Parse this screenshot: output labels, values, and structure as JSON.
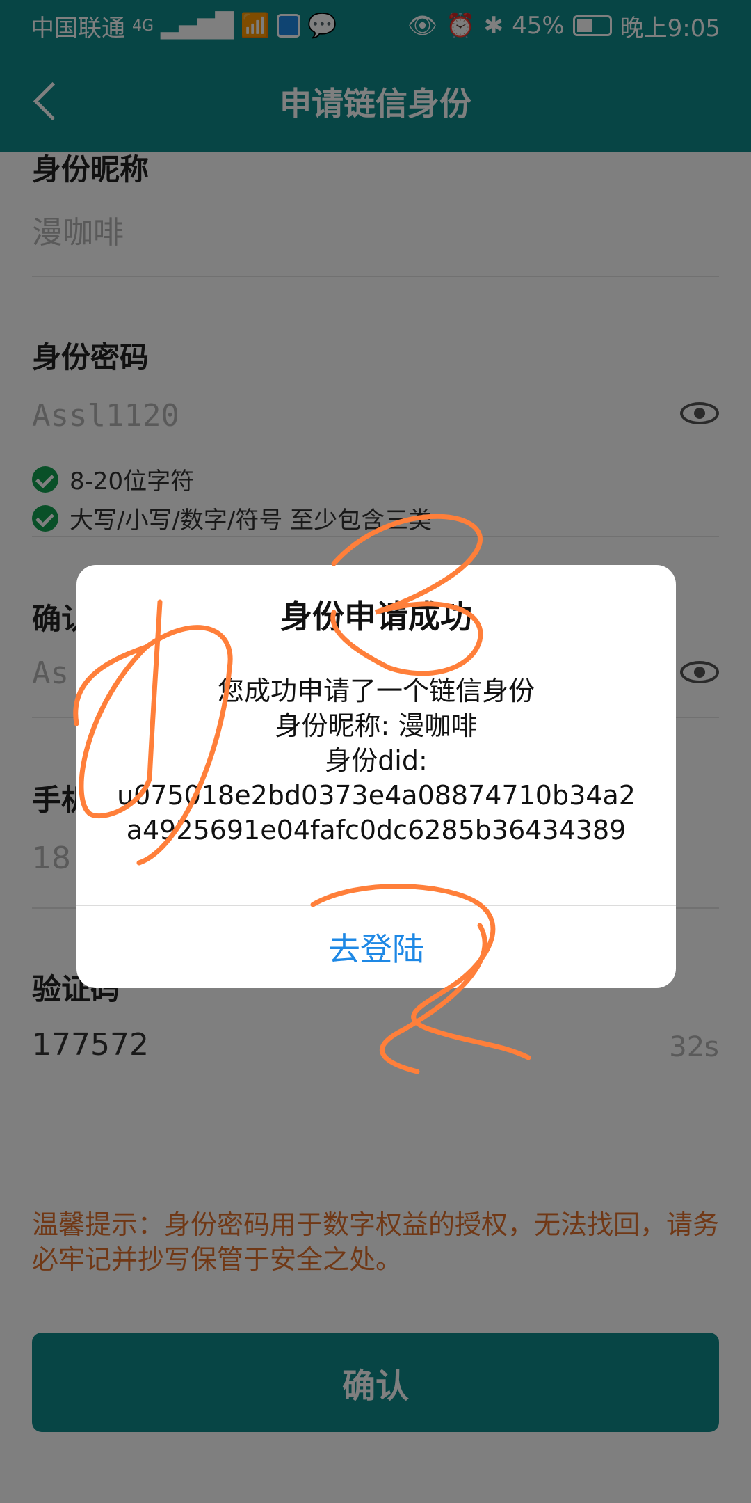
{
  "status_bar": {
    "carrier": "中国联通",
    "network": "4G",
    "battery": "45%",
    "time": "晚上9:05"
  },
  "app_bar": {
    "title": "申请链信身份"
  },
  "form": {
    "nickname_label": "身份昵称",
    "nickname_value": "漫咖啡",
    "password_label": "身份密码",
    "password_value": "Assl1120",
    "rules": [
      "8-20位字符",
      "大写/小写/数字/符号 至少包含三类"
    ],
    "confirm_label": "确认",
    "confirm_value": "As",
    "phone_label": "手机",
    "phone_value": "18",
    "code_label": "验证码",
    "code_value": "177572",
    "countdown": "32s"
  },
  "tip": "温馨提示：身份密码用于数字权益的授权，无法找回，请务必牢记并抄写保管于安全之处。",
  "confirm_button": "确认",
  "dialog": {
    "title": "身份申请成功",
    "line1": "您成功申请了一个链信身份",
    "line2": "身份昵称:   漫咖啡",
    "line3": "身份did:",
    "line4": "u075018e2bd0373e4a08874710b34a2",
    "line5": "a4925691e04fafc0dc6285b36434389",
    "action": "去登陆"
  },
  "colors": {
    "primary": "#0f8a8b",
    "accent": "#1e88e5",
    "tip": "#e0702c",
    "annotation": "#ff7f3a"
  }
}
